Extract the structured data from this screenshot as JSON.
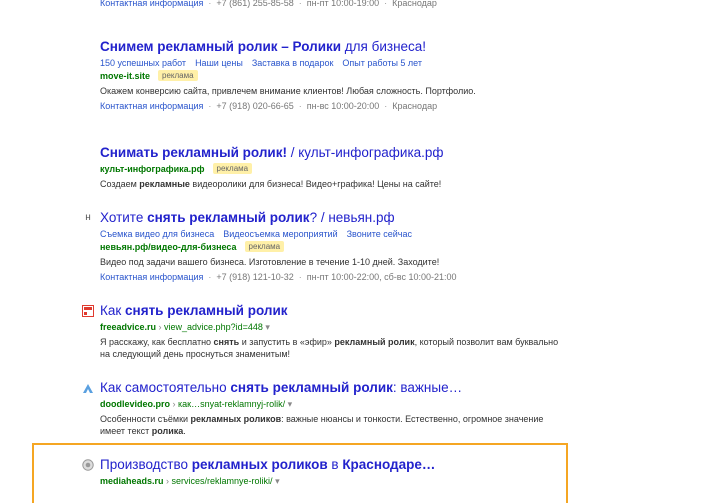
{
  "top_contact": {
    "link": "Контактная информация",
    "phone": "+7 (861) 255-85-58",
    "hours": "пн-пт 10:00-19:00",
    "city": "Краснодар"
  },
  "results": [
    {
      "title_pre": "Снимем рекламный ролик – Ролики",
      "title_post": " для бизнеса!",
      "sitelinks": [
        "150 успешных работ",
        "Наши цены",
        "Заставка в подарок",
        "Опыт работы 5 лет"
      ],
      "url": "move-it.site",
      "ad_label": "реклама",
      "snippet": "Окажем конверсию сайта, привлечем внимание клиентов! Любая сложность. Портфолио.",
      "contact": {
        "link": "Контактная информация",
        "phone": "+7 (918) 020-66-65",
        "hours": "пн-вс 10:00-20:00",
        "city": "Краснодар"
      }
    },
    {
      "title_pre": "Снимать рекламный ролик!",
      "title_post": " / культ-инфографика.рф",
      "url": "культ-инфографика.рф",
      "ad_label": "реклама",
      "snippet_a": "Создаем ",
      "snippet_b": "рекламные",
      "snippet_c": " видеоролики для бизнеса! Видео+графика! Цены на сайте!"
    },
    {
      "favicon": "н",
      "title_a": "Хотите ",
      "title_b": "снять рекламный ролик",
      "title_c": "? / невьян.рф",
      "sitelinks": [
        "Съемка видео для бизнеса",
        "Видеосъемка мероприятий",
        "Звоните сейчас"
      ],
      "url": "невьян.рф/видео-для-бизнеса",
      "ad_label": "реклама",
      "snippet": "Видео под задачи вашего бизнеса. Изготовление в течение 1-10 дней. Заходите!",
      "contact": {
        "link": "Контактная информация",
        "phone": "+7 (918) 121-10-32",
        "hours": "пн-пт 10:00-22:00, сб-вс 10:00-21:00"
      }
    },
    {
      "title_a": "Как ",
      "title_b": "снять рекламный ролик",
      "url": "freeadvice.ru",
      "path": "view_advice.php?id=448",
      "snippet_a": "Я расскажу, как бесплатно ",
      "snippet_b": "снять",
      "snippet_c": " и запустить в «эфир» ",
      "snippet_d": "рекламный ролик",
      "snippet_e": ", который позволит вам буквально на следующий день проснуться знаменитым!"
    },
    {
      "title_a": "Как самостоятельно ",
      "title_b": "снять рекламный ролик",
      "title_c": ": важные…",
      "url": "doodlevideo.pro",
      "path": "как…snyat-reklamnyj-rolik/",
      "snippet_a": "Особенности съёмки ",
      "snippet_b": "рекламных роликов",
      "snippet_c": ": важные нюансы и тонкости. Естественно, огромное значение имеет текст ",
      "snippet_d": "ролика",
      "snippet_e": "."
    },
    {
      "title_a": "Производство ",
      "title_b": "рекламных роликов",
      "title_c": " в ",
      "title_d": "Краснодаре…",
      "url": "mediaheads.ru",
      "path": "services/reklamnye-roliki/"
    }
  ],
  "colors": {
    "link": "#2222cc",
    "url": "#007700",
    "ad_bg": "#fff0a8",
    "highlight": "#f5a623"
  }
}
